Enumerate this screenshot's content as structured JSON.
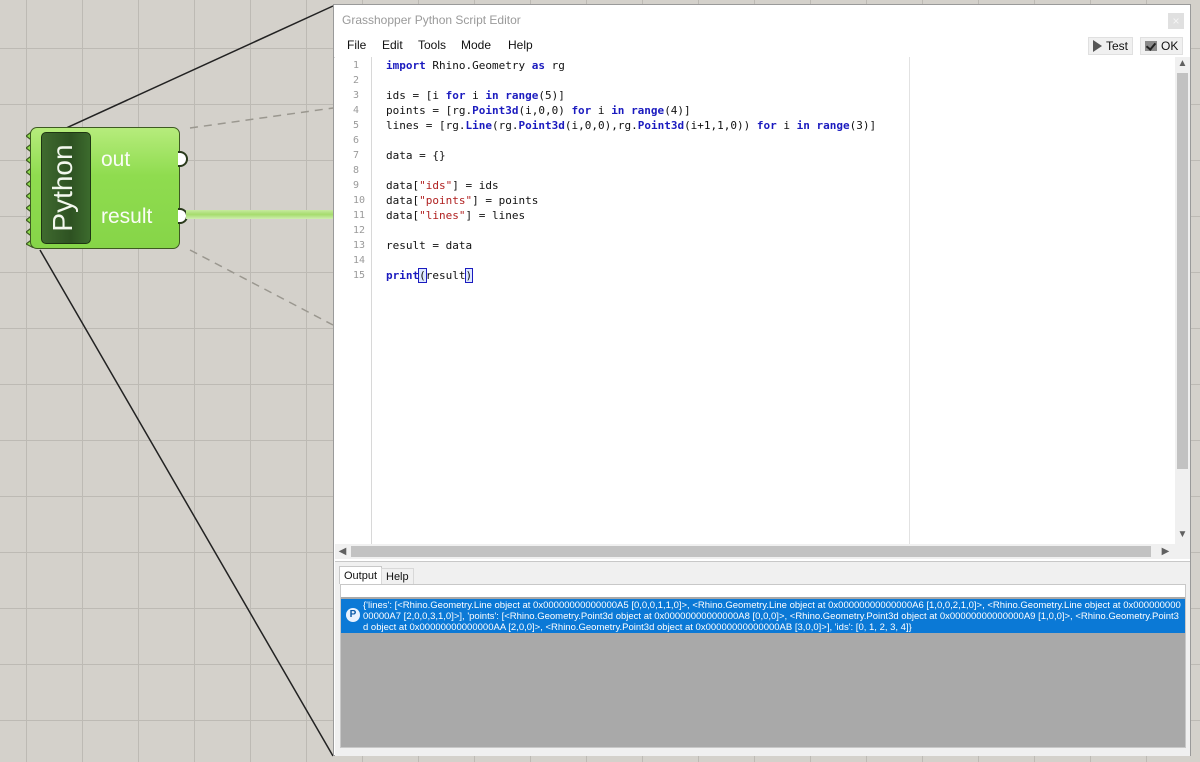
{
  "canvas": {
    "component": {
      "name": "Python",
      "outputs": [
        "out",
        "result"
      ]
    }
  },
  "window": {
    "title": "Grasshopper Python Script Editor",
    "close_label": "×",
    "menu": [
      "File",
      "Edit",
      "Tools",
      "Mode",
      "Help"
    ],
    "test_label": "Test",
    "ok_label": "OK"
  },
  "editor": {
    "line_numbers": [
      "1",
      "2",
      "3",
      "4",
      "5",
      "6",
      "7",
      "8",
      "9",
      "10",
      "11",
      "12",
      "13",
      "14",
      "15"
    ],
    "lines": [
      [
        {
          "t": "import",
          "k": "kw"
        },
        {
          "t": " Rhino.Geometry "
        },
        {
          "t": "as",
          "k": "kw"
        },
        {
          "t": " rg"
        }
      ],
      [],
      [
        {
          "t": "ids = [i "
        },
        {
          "t": "for",
          "k": "kw"
        },
        {
          "t": " i "
        },
        {
          "t": "in",
          "k": "kw"
        },
        {
          "t": " "
        },
        {
          "t": "range",
          "k": "kw"
        },
        {
          "t": "(5)]"
        }
      ],
      [
        {
          "t": "points = [rg."
        },
        {
          "t": "Point3d",
          "k": "kw"
        },
        {
          "t": "(i,0,0) "
        },
        {
          "t": "for",
          "k": "kw"
        },
        {
          "t": " i "
        },
        {
          "t": "in",
          "k": "kw"
        },
        {
          "t": " "
        },
        {
          "t": "range",
          "k": "kw"
        },
        {
          "t": "(4)]"
        }
      ],
      [
        {
          "t": "lines = [rg."
        },
        {
          "t": "Line",
          "k": "kw"
        },
        {
          "t": "(rg."
        },
        {
          "t": "Point3d",
          "k": "kw"
        },
        {
          "t": "(i,0,0),rg."
        },
        {
          "t": "Point3d",
          "k": "kw"
        },
        {
          "t": "(i+1,1,0)) "
        },
        {
          "t": "for",
          "k": "kw"
        },
        {
          "t": " i "
        },
        {
          "t": "in",
          "k": "kw"
        },
        {
          "t": " "
        },
        {
          "t": "range",
          "k": "kw"
        },
        {
          "t": "(3)]"
        }
      ],
      [],
      [
        {
          "t": "data = {}"
        }
      ],
      [],
      [
        {
          "t": "data["
        },
        {
          "t": "\"ids\"",
          "k": "str"
        },
        {
          "t": "] = ids"
        }
      ],
      [
        {
          "t": "data["
        },
        {
          "t": "\"points\"",
          "k": "str"
        },
        {
          "t": "] = points"
        }
      ],
      [
        {
          "t": "data["
        },
        {
          "t": "\"lines\"",
          "k": "str"
        },
        {
          "t": "] = lines"
        }
      ],
      [],
      [
        {
          "t": "result = data"
        }
      ],
      [],
      [
        {
          "t": "print",
          "k": "kw"
        },
        {
          "t": "(",
          "k": "bracket"
        },
        {
          "t": "result"
        },
        {
          "t": ")",
          "k": "bracket"
        }
      ]
    ]
  },
  "output": {
    "tabs": [
      "Output",
      "Help"
    ],
    "icon_label": "P",
    "text": "{'lines': [<Rhino.Geometry.Line object at 0x00000000000000A5 [0,0,0,1,1,0]>, <Rhino.Geometry.Line object at 0x00000000000000A6 [1,0,0,2,1,0]>, <Rhino.Geometry.Line object at 0x00000000000000A7 [2,0,0,3,1,0]>], 'points': [<Rhino.Geometry.Point3d object at 0x00000000000000A8 [0,0,0]>, <Rhino.Geometry.Point3d object at 0x00000000000000A9 [1,0,0]>, <Rhino.Geometry.Point3d object at 0x00000000000000AA [2,0,0]>, <Rhino.Geometry.Point3d object at 0x00000000000000AB [3,0,0]>], 'ids': [0, 1, 2, 3, 4]}"
  }
}
